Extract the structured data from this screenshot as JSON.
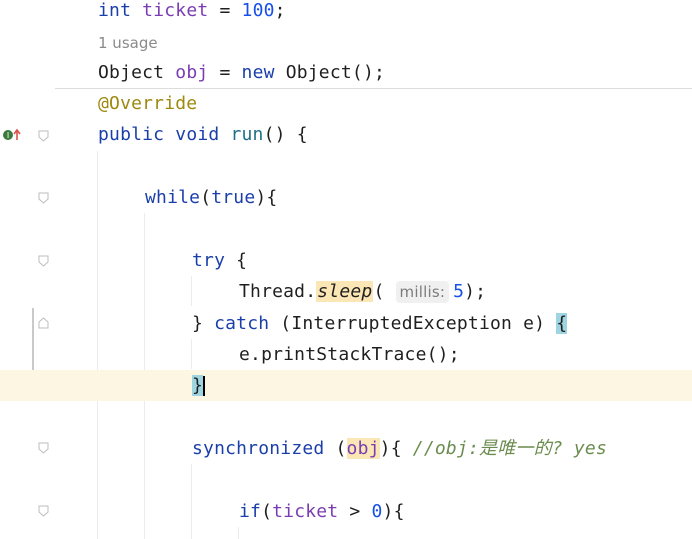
{
  "editor": {
    "lines": {
      "ticket": {
        "kw": "int",
        "name": "ticket",
        "eq": " = ",
        "val": "100",
        "end": ";"
      },
      "usage": "1 usage",
      "obj": {
        "type": "Object",
        "name": "obj",
        "eq": " = ",
        "kw_new": "new",
        "ctor": " Object();"
      },
      "override": "@Override",
      "run": {
        "kw1": "public",
        "kw2": "void",
        "name": "run",
        "rest": "() {"
      },
      "while": {
        "kw": "while",
        "open": "(",
        "cond": "true",
        "close": "){"
      },
      "try": {
        "kw": "try",
        "rest": " {"
      },
      "sleep": {
        "cls": "Thread.",
        "method": "sleep",
        "open": "( ",
        "hint": "millis:",
        "val": "5",
        "end": ");"
      },
      "catch": {
        "close": "} ",
        "kw": "catch",
        "params": " (InterruptedException e) ",
        "brace": "{"
      },
      "print": "e.printStackTrace();",
      "closebrace": "}",
      "sync": {
        "kw": "synchronized",
        "open": " (",
        "obj": "obj",
        "close": "){ ",
        "comment": "//obj:是唯一的? yes"
      },
      "if": {
        "kw": "if",
        "open": "(",
        "name": "ticket",
        "rest": " > ",
        "val": "0",
        "end": "){"
      }
    },
    "gutter_icons": [
      "implements-override-icon",
      "fold-icons"
    ],
    "colors": {
      "keyword": "#1a3faa",
      "field": "#7a3cb3",
      "number": "#1750eb",
      "annotation": "#9e880d",
      "comment": "#6b8c4e"
    }
  }
}
